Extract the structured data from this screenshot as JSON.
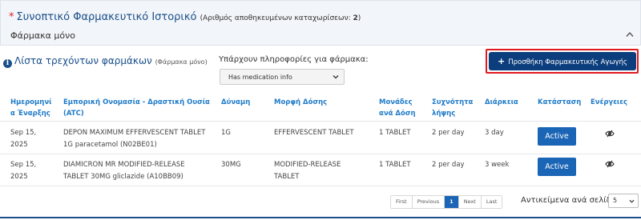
{
  "header": {
    "required_mark": "*",
    "title": "Συνοπτικό Φαρμακευτικό Ιστορικό",
    "count_prefix": "(Αριθμός αποθηκευμένων καταχωρίσεων: ",
    "count_value": "2",
    "count_suffix": ")",
    "subtitle": "Φάρμακα μόνο"
  },
  "list": {
    "title": "Λίστα τρεχόντων φαρμάκων",
    "title_note": "(Φάρμακα μόνο)",
    "info_glyph": "i"
  },
  "filter": {
    "label": "Υπάρχουν πληροφορίες για φάρμακα:",
    "selected": "Has medication info"
  },
  "add_button": {
    "icon": "+",
    "label": "Προσθήκη Φαρμακευτικής Αγωγής"
  },
  "table": {
    "headers": {
      "start_date": "Ημερομηνί α Έναρξης",
      "trade_name": "Εμπορική Ονομασία - Δραστική Ουσία (ATC)",
      "strength": "Δύναμη",
      "form": "Μορφή Δόσης",
      "units": "Μονάδες ανά Δόση",
      "frequency": "Συχνότητα λήψης",
      "duration": "Διάρκεια",
      "status": "Κατάσταση",
      "actions": "Ενέργειες"
    },
    "rows": [
      {
        "date_1": "Sep 15,",
        "date_2": "2025",
        "name_1": "DEPON MAXIMUM EFFERVESCENT TABLET",
        "name_2": "1G paracetamol (N02BE01)",
        "strength": "1G",
        "form_1": "EFFERVESCENT TABLET",
        "form_2": "",
        "units": "1 TABLET",
        "frequency": "2 per day",
        "duration": "3 day",
        "status": "Active",
        "action_icon": "pill-eye-icon"
      },
      {
        "date_1": "Sep 15,",
        "date_2": "2025",
        "name_1": "DIAMICRON MR MODIFIED-RELEASE",
        "name_2": "TABLET 30MG gliclazide (A10BB09)",
        "strength": "30MG",
        "form_1": "MODIFIED-RELEASE",
        "form_2": "TABLET",
        "units": "1 TABLET",
        "frequency": "2 per day",
        "duration": "3 week",
        "status": "Active",
        "action_icon": "pill-eye-icon"
      }
    ]
  },
  "pagination": {
    "first": "First",
    "previous": "Previous",
    "current": "1",
    "next": "Next",
    "last": "Last"
  },
  "per_page": {
    "label": "Αντικείμενα ανά σελίδα:",
    "value": "5"
  },
  "colors": {
    "primary": "#0c3e7d",
    "accent": "#1b65b6",
    "header_text": "#1f7bc8",
    "highlight": "#e0191f"
  }
}
